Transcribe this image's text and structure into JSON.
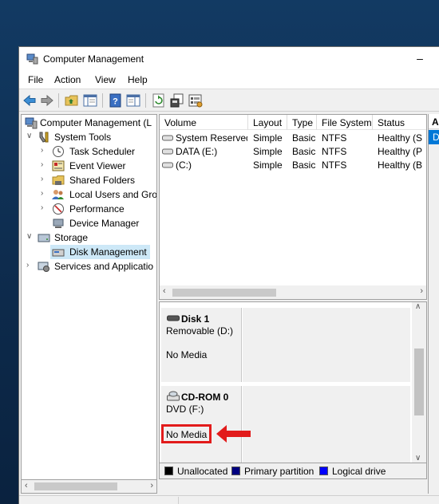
{
  "window": {
    "title": "Computer Management",
    "minimize": "–"
  },
  "menu": {
    "file": "File",
    "action": "Action",
    "view": "View",
    "help": "Help"
  },
  "toolbar": {
    "icons": [
      "back-arrow-icon",
      "forward-arrow-icon",
      "up-folder-icon",
      "show-hide-tree-icon",
      "help-icon",
      "properties-pane-icon",
      "refresh-icon",
      "properties-icon",
      "export-list-icon"
    ]
  },
  "tree": {
    "root": "Computer Management (L",
    "system_tools": "System Tools",
    "task_scheduler": "Task Scheduler",
    "event_viewer": "Event Viewer",
    "shared_folders": "Shared Folders",
    "local_users": "Local Users and Gro",
    "performance": "Performance",
    "device_manager": "Device Manager",
    "storage": "Storage",
    "disk_management": "Disk Management",
    "services": "Services and Applicatio"
  },
  "volumes": {
    "headers": {
      "volume": "Volume",
      "layout": "Layout",
      "type": "Type",
      "fs": "File System",
      "status": "Status"
    },
    "rows": [
      {
        "volume": "System Reserved",
        "layout": "Simple",
        "type": "Basic",
        "fs": "NTFS",
        "status": "Healthy (S"
      },
      {
        "volume": "DATA (E:)",
        "layout": "Simple",
        "type": "Basic",
        "fs": "NTFS",
        "status": "Healthy (P"
      },
      {
        "volume": "(C:)",
        "layout": "Simple",
        "type": "Basic",
        "fs": "NTFS",
        "status": "Healthy (B"
      }
    ]
  },
  "actions_pane": {
    "header": "A",
    "selected": "D"
  },
  "disks": [
    {
      "name": "Disk 1",
      "kind": "Removable (D:)",
      "media": "No Media"
    },
    {
      "name": "CD-ROM 0",
      "kind": "DVD (F:)",
      "media": "No Media"
    }
  ],
  "legend": {
    "unallocated": "Unallocated",
    "primary": "Primary partition",
    "logical": "Logical drive",
    "colors": {
      "unallocated": "#000000",
      "primary": "#000080",
      "logical": "#0000ff"
    }
  },
  "highlight_color": "#e21b1b"
}
